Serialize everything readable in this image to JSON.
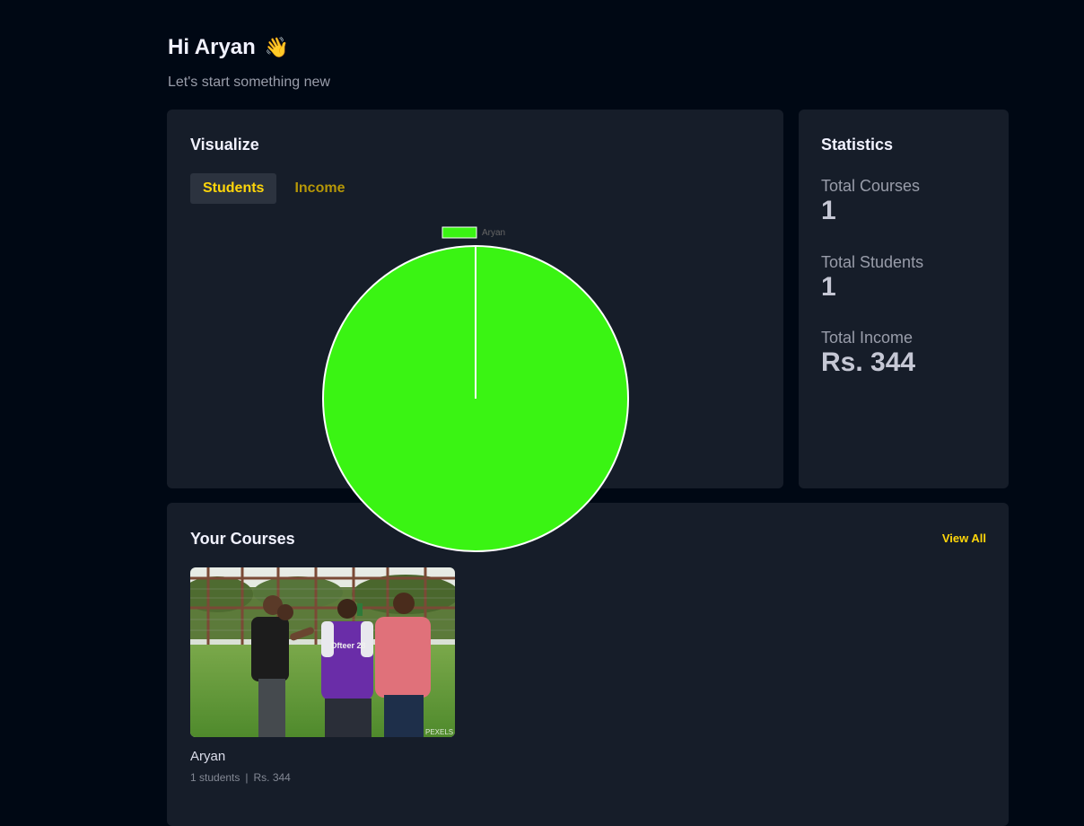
{
  "header": {
    "greeting": "Hi Aryan",
    "wave_icon": "👋",
    "subtitle": "Let's start something new"
  },
  "visualize": {
    "title": "Visualize",
    "tabs": [
      {
        "label": "Students",
        "active": true
      },
      {
        "label": "Income",
        "active": false
      }
    ]
  },
  "statistics": {
    "title": "Statistics",
    "items": [
      {
        "label": "Total Courses",
        "value": "1"
      },
      {
        "label": "Total Students",
        "value": "1"
      },
      {
        "label": "Total Income",
        "value": "Rs. 344"
      }
    ]
  },
  "courses": {
    "title": "Your Courses",
    "view_all_label": "View All",
    "items": [
      {
        "title": "Aryan",
        "students": "1 students",
        "separator": "|",
        "price": "Rs. 344",
        "thumbnail_icon": "course-photo-players-on-field"
      }
    ]
  },
  "chart_data": {
    "type": "pie",
    "categories": [
      "Aryan"
    ],
    "values": [
      1
    ],
    "colors": [
      "#3af413"
    ],
    "legend": "top"
  },
  "colors": {
    "page_bg": "#000814",
    "card_bg": "#161d29",
    "accent_yellow": "#ffd60a",
    "pie_green": "#3af413"
  }
}
